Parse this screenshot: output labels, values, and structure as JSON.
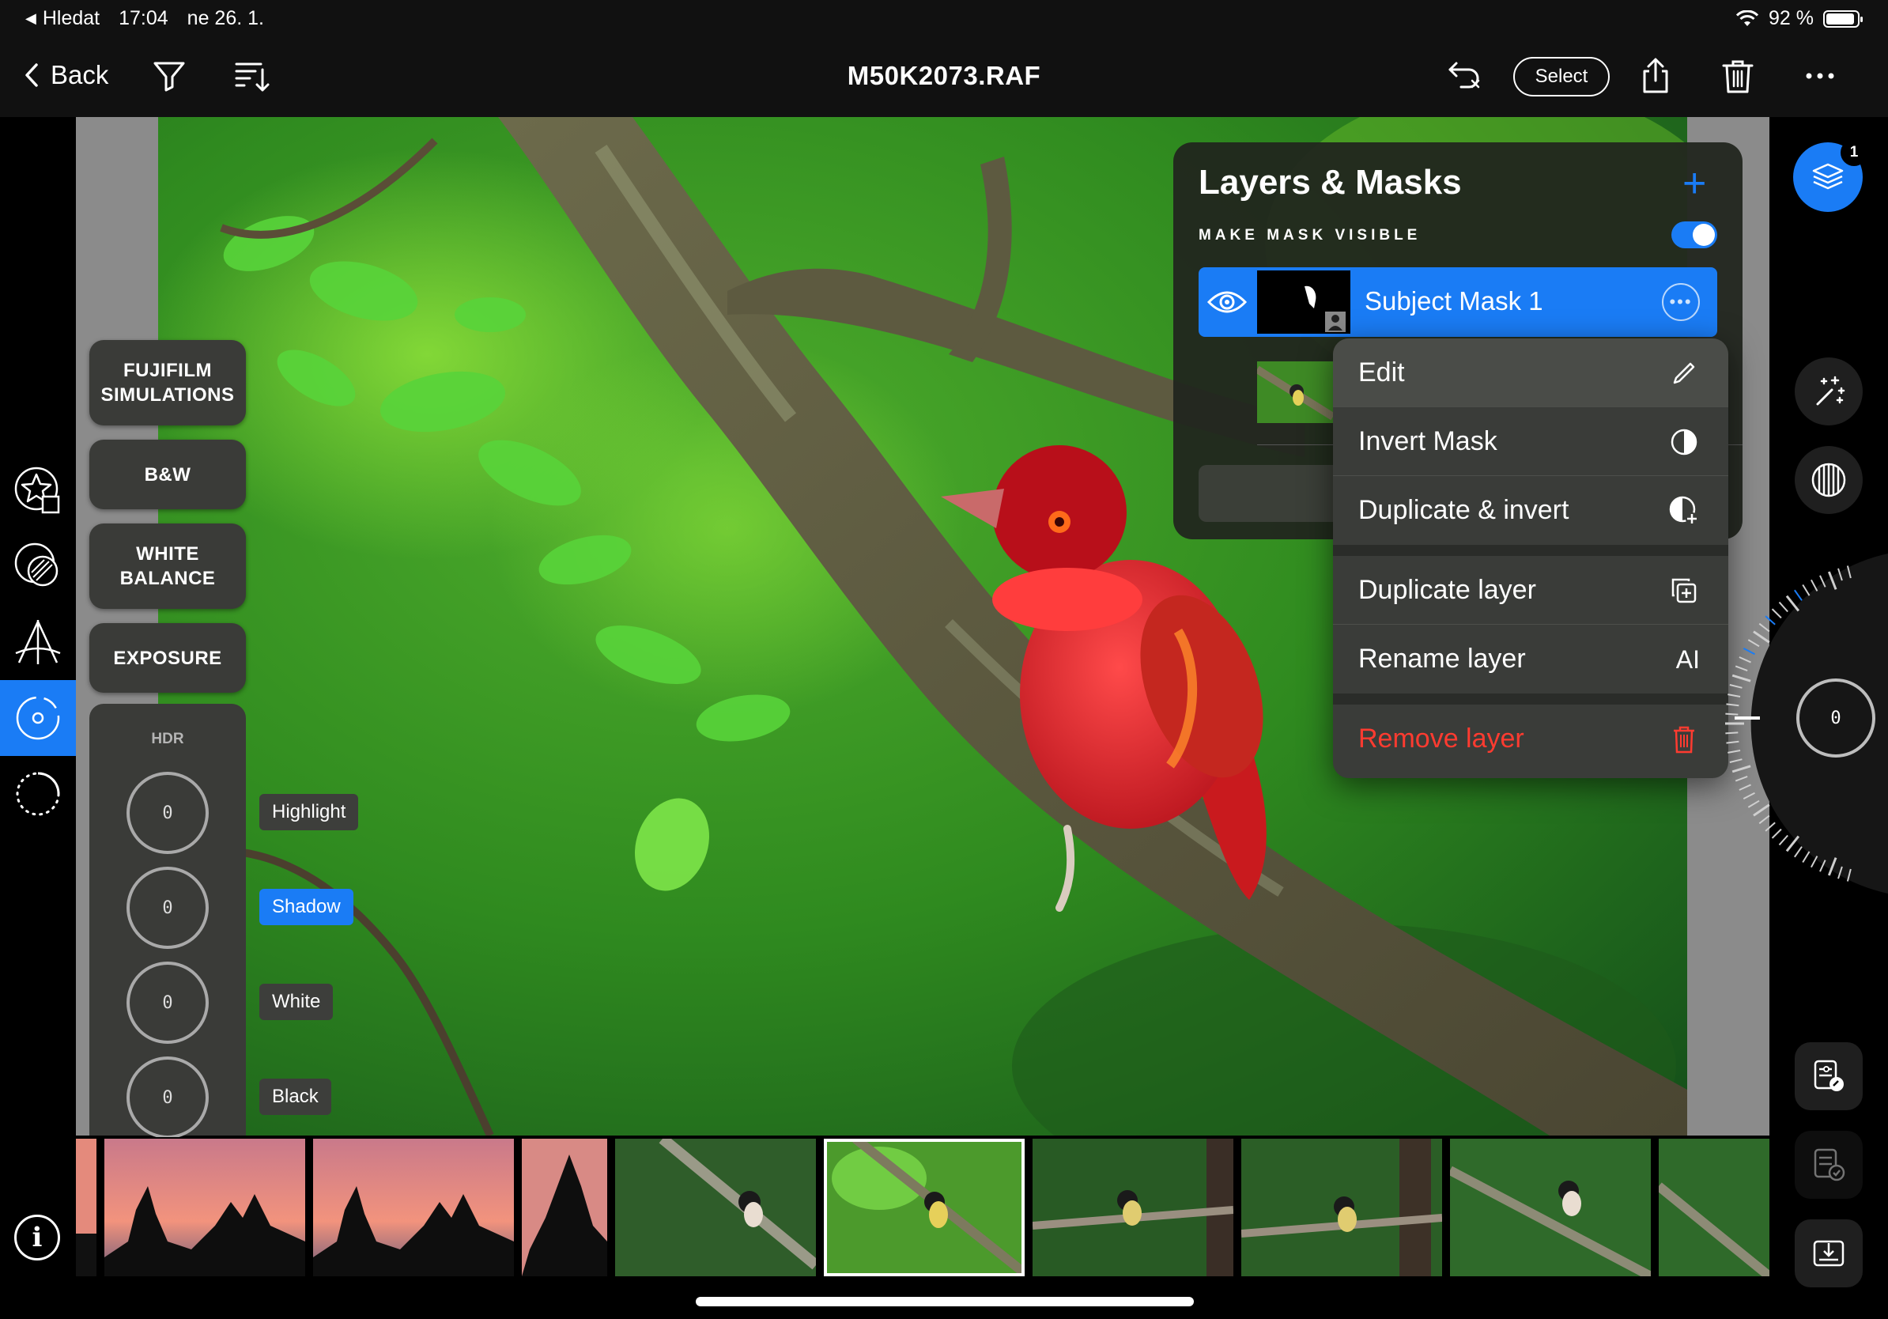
{
  "status_bar": {
    "back_app": "Hledat",
    "time": "17:04",
    "date": "ne 26. 1.",
    "battery": "92 %",
    "battery_level": 0.92
  },
  "toolbar": {
    "back_label": "Back",
    "title": "M50K2073.RAF",
    "select_label": "Select"
  },
  "tools": {
    "fujifilm_line1": "FUJIFILM",
    "fujifilm_line2": "SIMULATIONS",
    "bw": "B&W",
    "wb_line1": "WHITE",
    "wb_line2": "BALANCE",
    "exposure": "EXPOSURE",
    "hdr": {
      "title": "HDR",
      "values": [
        "0",
        "0",
        "0",
        "0"
      ],
      "labels": [
        "Highlight",
        "Shadow",
        "White",
        "Black"
      ],
      "active": "Shadow"
    }
  },
  "layers": {
    "title": "Layers & Masks",
    "add": "+",
    "mask_visible_label": "MAKE MASK VISIBLE",
    "mask_visible": true,
    "layer_name": "Subject Mask 1"
  },
  "context_menu": {
    "items": [
      "Edit",
      "Invert Mask",
      "Duplicate & invert",
      "Duplicate layer",
      "Rename layer",
      "Remove layer"
    ],
    "rename_icon_text": "A"
  },
  "right_rail": {
    "layers_badge": "1",
    "dial_value": "0"
  },
  "colors": {
    "accent": "#1a7cf5",
    "danger": "#ff3b30",
    "panel": "#3a3b38"
  }
}
